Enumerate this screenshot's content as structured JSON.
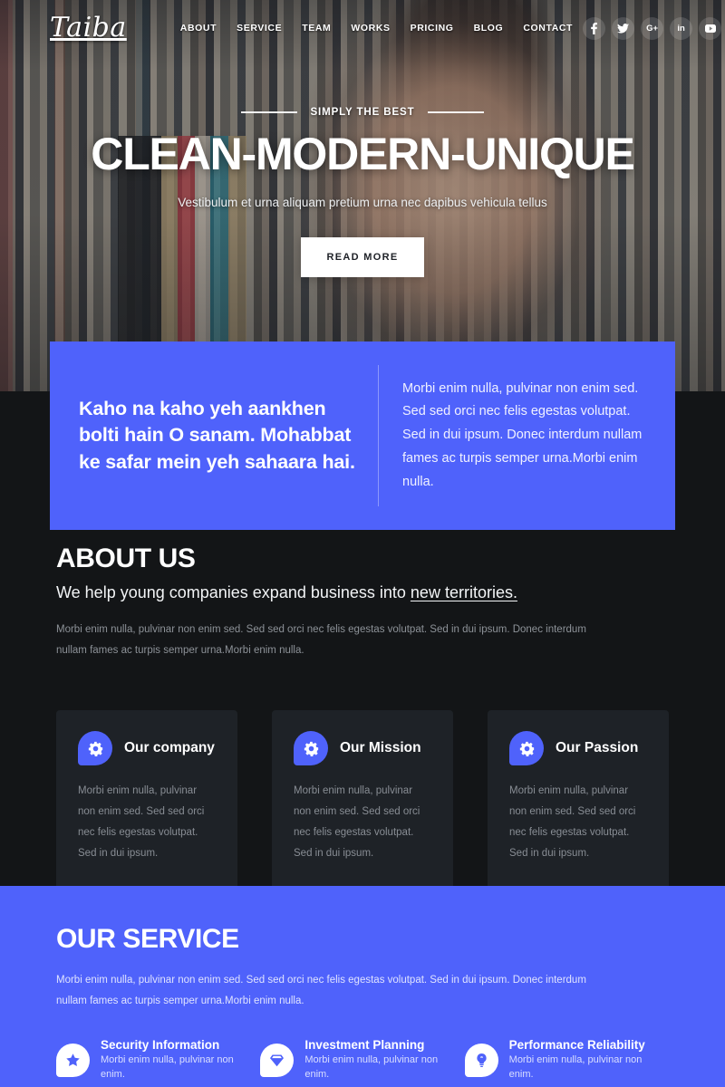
{
  "brand": {
    "logo_text": "Taiba"
  },
  "nav": {
    "items": [
      {
        "label": "ABOUT"
      },
      {
        "label": "SERVICE"
      },
      {
        "label": "TEAM"
      },
      {
        "label": "WORKS"
      },
      {
        "label": "PRICING"
      },
      {
        "label": "BLOG"
      },
      {
        "label": "CONTACT"
      }
    ]
  },
  "socials": [
    {
      "name": "facebook-icon",
      "glyph": "f"
    },
    {
      "name": "twitter-icon",
      "glyph": "t"
    },
    {
      "name": "google-plus-icon",
      "glyph": "G+"
    },
    {
      "name": "linkedin-icon",
      "glyph": "in"
    },
    {
      "name": "youtube-icon",
      "glyph": "yt"
    }
  ],
  "hero": {
    "kicker": "SIMPLY THE BEST",
    "title": "CLEAN-MODERN-UNIQUE",
    "subtitle": "Vestibulum et urna aliquam pretium urna nec dapibus vehicula tellus",
    "cta_label": "READ MORE"
  },
  "quote": {
    "headline": "Kaho na kaho yeh aankhen bolti hain O sanam. Mohabbat ke safar mein yeh sahaara hai.",
    "body": "Morbi enim nulla, pulvinar non enim sed. Sed sed orci nec felis egestas volutpat. Sed in dui ipsum. Donec interdum nullam fames ac turpis semper urna.Morbi enim nulla."
  },
  "about": {
    "title": "ABOUT US",
    "lead_prefix": "We help young companies expand business into ",
    "lead_link": "new territories.",
    "body": "Morbi enim nulla, pulvinar non enim sed. Sed sed orci nec felis egestas volutpat. Sed in dui ipsum. Donec interdum nullam fames ac turpis semper urna.Morbi enim nulla."
  },
  "cards": [
    {
      "icon": "gear-icon",
      "title": "Our company",
      "body": "Morbi enim nulla, pulvinar non enim sed. Sed sed orci nec felis egestas volutpat. Sed in dui ipsum."
    },
    {
      "icon": "gear-icon",
      "title": "Our Mission",
      "body": "Morbi enim nulla, pulvinar non enim sed. Sed sed orci nec felis egestas volutpat. Sed in dui ipsum."
    },
    {
      "icon": "gear-icon",
      "title": "Our Passion",
      "body": "Morbi enim nulla, pulvinar non enim sed. Sed sed orci nec felis egestas volutpat. Sed in dui ipsum."
    }
  ],
  "service": {
    "title": "OUR SERVICE",
    "body": "Morbi enim nulla, pulvinar non enim sed. Sed sed orci nec felis egestas volutpat. Sed in dui ipsum. Donec interdum nullam fames ac turpis semper urna.Morbi enim nulla.",
    "items": [
      {
        "icon": "star-icon",
        "title": "Security Information",
        "subtitle": "Morbi enim nulla, pulvinar non enim."
      },
      {
        "icon": "diamond-icon",
        "title": "Investment Planning",
        "subtitle": "Morbi enim nulla, pulvinar non enim."
      },
      {
        "icon": "lightbulb-icon",
        "title": "Performance Reliability",
        "subtitle": "Morbi enim nulla, pulvinar non enim."
      }
    ]
  },
  "colors": {
    "accent": "#4f62fb",
    "page_background": "#131517",
    "card_background": "#1e2227",
    "text_light": "#ffffff",
    "text_muted": "#8d9298"
  }
}
